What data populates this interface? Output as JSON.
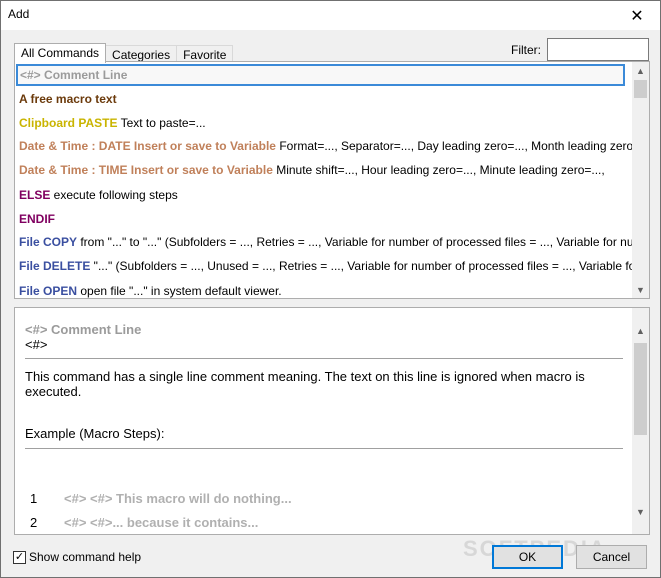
{
  "window": {
    "title": "Add",
    "close_glyph": "✕"
  },
  "tabs": [
    {
      "label": "All Commands",
      "active": true
    },
    {
      "label": "Categories",
      "active": false
    },
    {
      "label": "Favorite",
      "active": false
    }
  ],
  "filter": {
    "label": "Filter:",
    "value": ""
  },
  "commands": [
    {
      "name": "<#> Comment Line",
      "rest": "",
      "color": "#9b9b9b"
    },
    {
      "name": "A free macro text",
      "rest": "",
      "color": "#6b3a0b"
    },
    {
      "name": "Clipboard PASTE",
      "rest": " Text to paste=...",
      "color": "#c9b400"
    },
    {
      "name": "Date & Time : DATE Insert or save to Variable",
      "rest": " Format=..., Separator=..., Day leading zero=..., Month leading zero",
      "color": "#c0805a"
    },
    {
      "name": "Date & Time : TIME Insert or save to Variable",
      "rest": " Minute shift=..., Hour leading zero=..., Minute leading zero=...,",
      "color": "#c0805a"
    },
    {
      "name": "ELSE",
      "rest": " execute following steps",
      "color": "#800060"
    },
    {
      "name": "ENDIF",
      "rest": "",
      "color": "#800060"
    },
    {
      "name": "File COPY",
      "rest": " from \"...\" to \"...\" (Subfolders = ..., Retries = ..., Variable for number of processed files = ..., Variable for number",
      "color": "#3a4fa0"
    },
    {
      "name": "File DELETE",
      "rest": " \"...\" (Subfolders = ..., Unused = ..., Retries = ..., Variable for number of processed files = ..., Variable for",
      "color": "#3a4fa0"
    },
    {
      "name": "File OPEN",
      "rest": " open file \"...\" in system default viewer.",
      "color": "#3a4fa0"
    }
  ],
  "help": {
    "title": "<#> Comment Line",
    "syntax": "<#>",
    "description": "This command has a single line comment meaning. The text on this line is ignored when macro is executed.",
    "example_heading": "Example (Macro Steps):",
    "steps": [
      {
        "num": "1",
        "text": "<#> <#> This macro will do nothing..."
      },
      {
        "num": "2",
        "text": "<#> <#>... because it contains..."
      }
    ]
  },
  "show_help": {
    "label": "Show command help",
    "checked": true
  },
  "buttons": {
    "ok": "OK",
    "cancel": "Cancel"
  },
  "watermark": "SOFTPEDIA"
}
